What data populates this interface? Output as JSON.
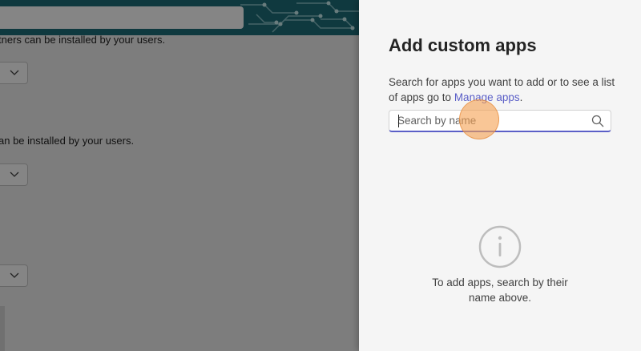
{
  "background_page": {
    "line1": "tners can be installed by your users.",
    "line2": "an be installed by your users.",
    "dropdowns": [
      {
        "icon": "chevron-down-icon"
      },
      {
        "icon": "chevron-down-icon"
      },
      {
        "icon": "chevron-down-icon"
      }
    ]
  },
  "panel": {
    "title": "Add custom apps",
    "description": "Search for apps you want to add or to see a list of apps go to ",
    "link_label": "Manage apps",
    "description_end": ".",
    "search": {
      "placeholder": "Search by name",
      "value": "",
      "icon": "search-icon"
    },
    "empty_state": {
      "icon": "info-icon",
      "message": "To add apps, search by their name above."
    }
  },
  "colors": {
    "accent": "#5b5fc7",
    "panel_bg": "#f5f5f5",
    "overlay": "rgba(0,0,0,0.48)",
    "click_indicator": "#f5a050"
  }
}
